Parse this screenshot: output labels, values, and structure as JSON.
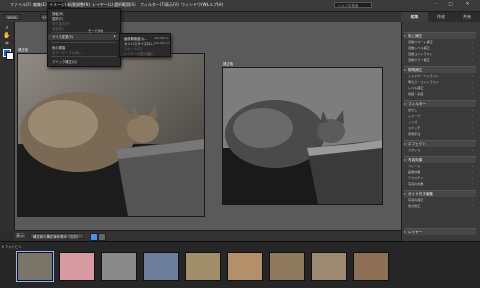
{
  "menubar": {
    "items": [
      "ファイル(F)",
      "編集(E)",
      "イメージ(I)",
      "画質調整(N)",
      "レイヤー(L)",
      "選択範囲(S)",
      "フィルター(T)",
      "表示(V)",
      "ウィンドウ(W)",
      "ヘルプ(H)"
    ],
    "search_placeholder": "ヘルプを検索"
  },
  "toolbar": {
    "zoom_label": "100%",
    "view_label": "ビュー"
  },
  "panel_tabs": [
    "編集",
    "作成",
    "共有"
  ],
  "image_menu": {
    "items": [
      {
        "label": "回転(R)",
        "disabled": false
      },
      {
        "label": "変形(T)",
        "disabled": false
      },
      {
        "label": "切り抜き(P)",
        "disabled": true
      },
      {
        "label": "分割(D)",
        "disabled": true
      },
      {
        "label": "モード(M)",
        "disabled": false
      },
      {
        "label": "サイズ変更(Z)",
        "disabled": false,
        "highlight": true
      },
      {
        "label": "色の置換",
        "disabled": false
      },
      {
        "label": "カラーテーブル(B)...",
        "disabled": true
      },
      {
        "label": "クイック補正(Q)",
        "disabled": false
      }
    ]
  },
  "size_submenu": {
    "items": [
      "画像解像度(I)...",
      "カンバスサイズ(S)...",
      "スケール(C)",
      "レイヤーの拡大縮小"
    ],
    "shortcuts": [
      "Alt+Ctrl+I",
      "Alt+Ctrl+C",
      "",
      ""
    ]
  },
  "canvas": {
    "label_before": "補正前",
    "label_after": "補正後"
  },
  "bottombar": {
    "label": "補正前と補正後を表示（左右）"
  },
  "right_panel": {
    "sections": [
      {
        "title": "色と補正",
        "items": [
          "自動スマート補正",
          "自動レベル補正",
          "自動コントラスト",
          "自動カラー補正"
        ]
      },
      {
        "title": "照明補正",
        "items": [
          "シャドウ・ハイライト",
          "明るさ・コントラスト",
          "レベル補正",
          "色相・彩度"
        ]
      },
      {
        "title": "フィルター",
        "items": [
          "ぼかし",
          "シャープ",
          "ノイズ",
          "スケッチ",
          "表現手法"
        ]
      },
      {
        "title": "エフェクト",
        "items": [
          "スタイル"
        ]
      },
      {
        "title": "写真効果",
        "items": [
          "フレーム",
          "画像効果",
          "テクスチャ",
          "写真の効果"
        ]
      },
      {
        "title": "ガイド付き編集",
        "items": [
          "写真の補正",
          "傷の修正"
        ]
      },
      {
        "title": "レイヤー",
        "items": []
      }
    ]
  },
  "filmstrip": {
    "count": 9
  },
  "colors": {
    "accent": "#4a8ef0",
    "canvas_bg": "#5a5a5a",
    "panel_bg": "#3a3a3a"
  }
}
